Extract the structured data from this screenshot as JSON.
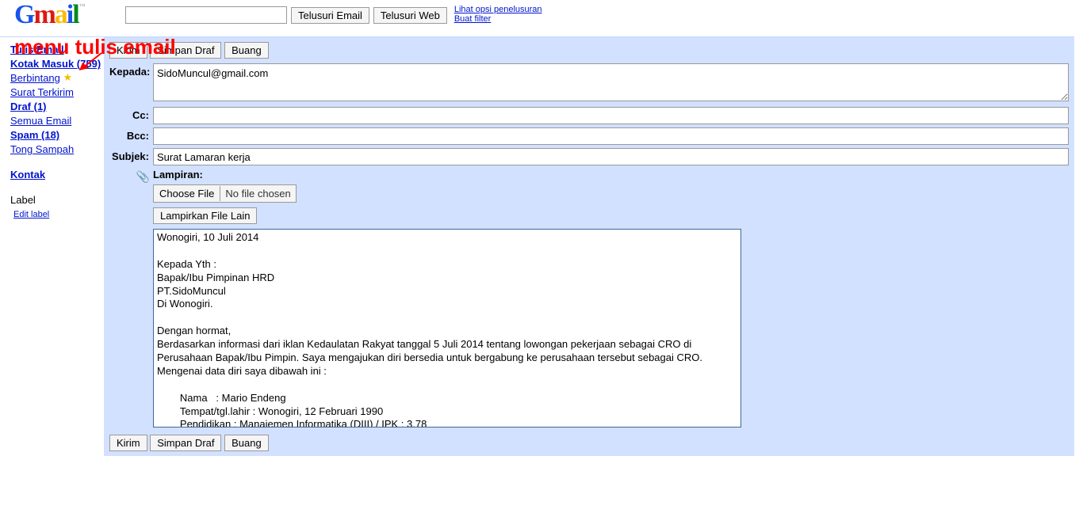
{
  "header": {
    "search_placeholder": "",
    "search_value": "",
    "btn_search_email": "Telusuri Email",
    "btn_search_web": "Telusuri Web",
    "link_search_options": "Lihat opsi penelusuran",
    "link_create_filter": "Buat filter"
  },
  "annotation": {
    "text": "menu tulis email"
  },
  "sidebar": {
    "compose": "Tulis Email",
    "inbox": "Kotak Masuk (759)",
    "starred": "Berbintang",
    "sent": "Surat Terkirim",
    "drafts": "Draf (1)",
    "all": "Semua Email",
    "spam": "Spam (18)",
    "trash": "Tong Sampah",
    "contacts": "Kontak",
    "label_head": "Label",
    "edit_label": "Edit label"
  },
  "compose": {
    "btn_send": "Kirim",
    "btn_save": "Simpan Draf",
    "btn_discard": "Buang",
    "lbl_to": "Kepada:",
    "lbl_cc": "Cc:",
    "lbl_bcc": "Bcc:",
    "lbl_subject": "Subjek:",
    "lbl_attach": "Lampiran:",
    "val_to": "SidoMuncul@gmail.com",
    "val_cc": "",
    "val_bcc": "",
    "val_subject": "Surat Lamaran kerja",
    "choose_file": "Choose File",
    "no_file": "No file chosen",
    "attach_more": "Lampirkan File Lain",
    "body": "Wonogiri, 10 Juli 2014\n\nKepada Yth :\nBapak/Ibu Pimpinan HRD\nPT.SidoMuncul\nDi Wonogiri.\n\nDengan hormat,\nBerdasarkan informasi dari iklan Kedaulatan Rakyat tanggal 5 Juli 2014 tentang lowongan pekerjaan sebagai CRO di Perusahaan Bapak/Ibu Pimpin. Saya mengajukan diri bersedia untuk bergabung ke perusahaan tersebut sebagai CRO. Mengenai data diri saya dibawah ini :\n\n        Nama   : Mario Endeng\n        Tempat/tgl.lahir : Wonogiri, 12 Februari 1990\n        Pendidikan : Manajemen Informatika (DIII) / IPK : 3,78"
  }
}
